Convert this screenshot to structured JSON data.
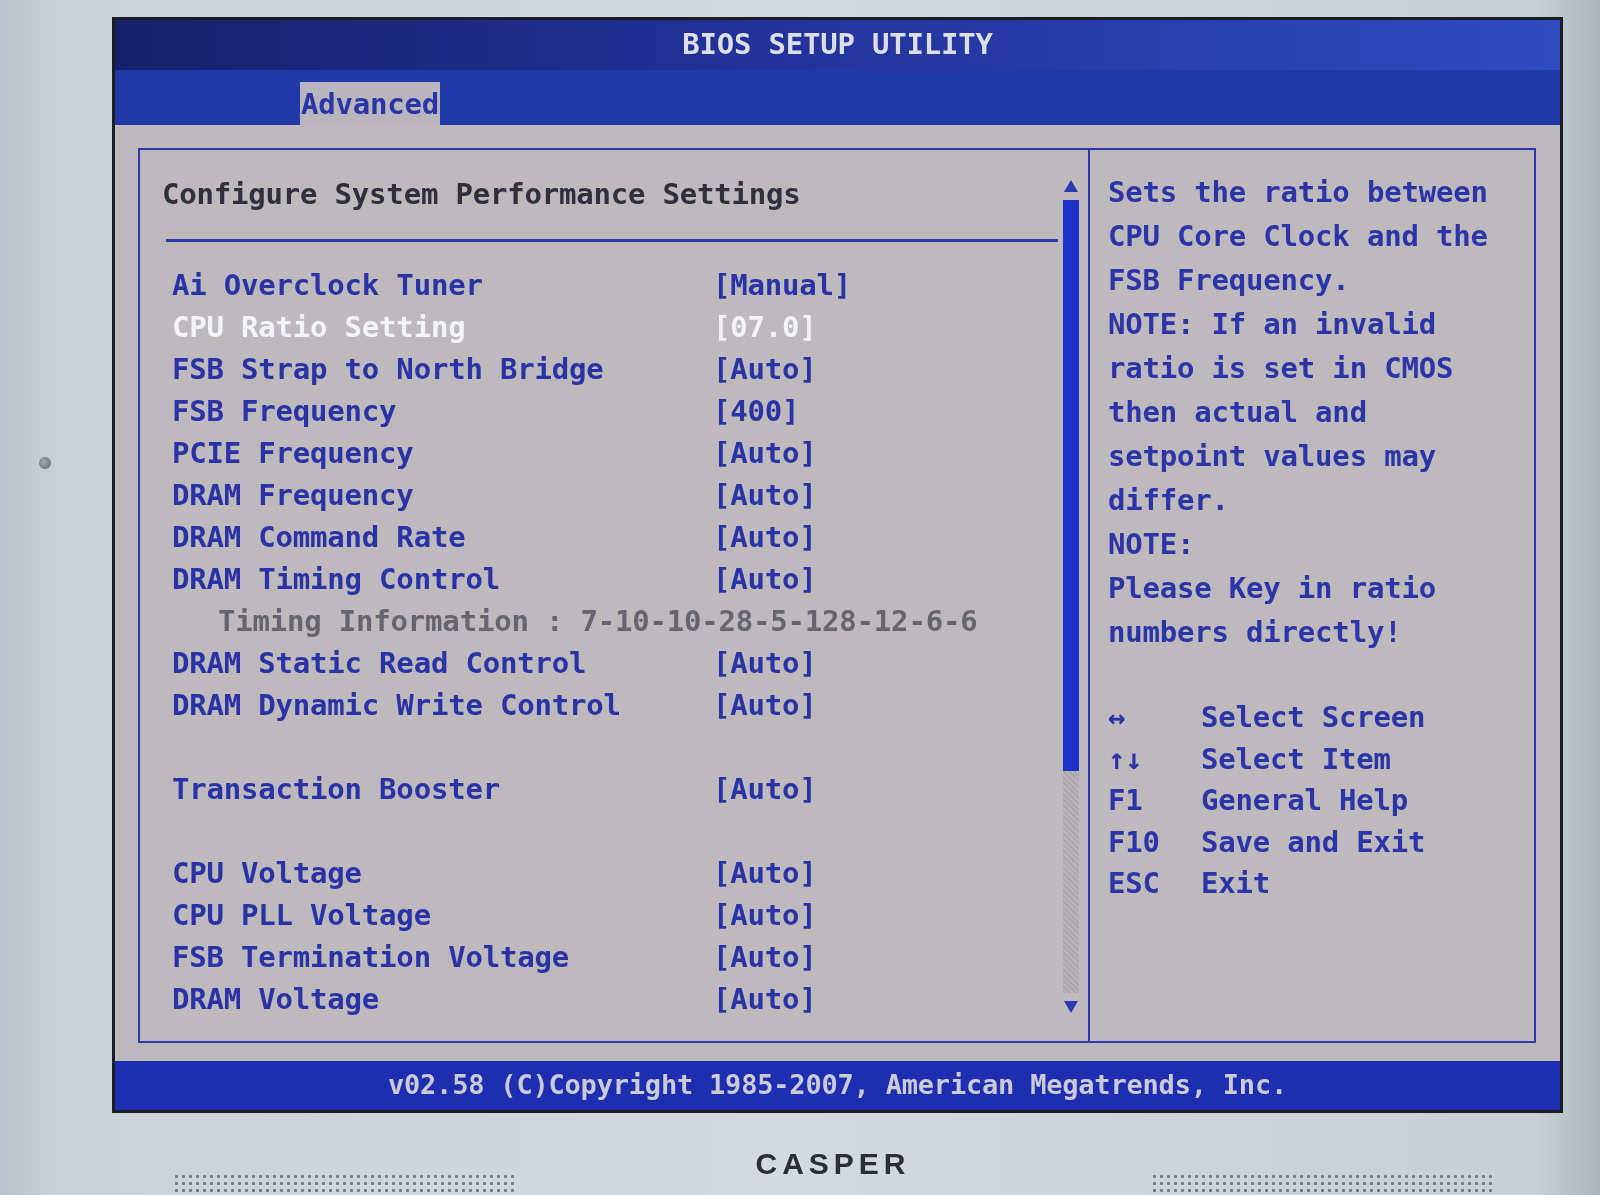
{
  "monitor": {
    "brand": "CASPER"
  },
  "bios": {
    "title": "BIOS SETUP UTILITY",
    "tabs": [
      {
        "label": "Advanced",
        "selected": true
      }
    ],
    "settings_panel": {
      "heading": "Configure System Performance Settings",
      "sections": [
        {
          "rows": [
            {
              "kind": "setting",
              "label": "Ai Overclock Tuner",
              "value": "[Manual]",
              "selected": false
            },
            {
              "kind": "setting",
              "label": "CPU Ratio Setting",
              "value": "[07.0]",
              "selected": true
            },
            {
              "kind": "setting",
              "label": "FSB Strap to North Bridge",
              "value": "[Auto]",
              "selected": false
            },
            {
              "kind": "setting",
              "label": "FSB Frequency",
              "value": "[400]",
              "selected": false
            },
            {
              "kind": "setting",
              "label": "PCIE Frequency",
              "value": "[Auto]",
              "selected": false
            },
            {
              "kind": "setting",
              "label": "DRAM Frequency",
              "value": "[Auto]",
              "selected": false
            },
            {
              "kind": "setting",
              "label": "DRAM Command Rate",
              "value": "[Auto]",
              "selected": false
            },
            {
              "kind": "setting",
              "label": "DRAM Timing Control",
              "value": "[Auto]",
              "selected": false
            },
            {
              "kind": "info",
              "text": "Timing Information : 7-10-10-28-5-128-12-6-6"
            },
            {
              "kind": "setting",
              "label": "DRAM Static Read Control",
              "value": "[Auto]",
              "selected": false
            },
            {
              "kind": "setting",
              "label": "DRAM Dynamic Write Control",
              "value": "[Auto]",
              "selected": false
            }
          ]
        },
        {
          "rows": [
            {
              "kind": "setting",
              "label": "Transaction Booster",
              "value": "[Auto]",
              "selected": false
            }
          ]
        },
        {
          "rows": [
            {
              "kind": "setting",
              "label": "CPU Voltage",
              "value": "[Auto]",
              "selected": false
            },
            {
              "kind": "setting",
              "label": "CPU PLL Voltage",
              "value": "[Auto]",
              "selected": false
            },
            {
              "kind": "setting",
              "label": "FSB Termination Voltage",
              "value": "[Auto]",
              "selected": false
            },
            {
              "kind": "setting",
              "label": "DRAM Voltage",
              "value": "[Auto]",
              "selected": false
            }
          ]
        }
      ]
    },
    "help_panel": {
      "paragraphs": [
        "Sets the ratio between CPU Core Clock and the FSB Frequency.",
        "NOTE: If an invalid ratio is set in CMOS then actual and setpoint values may differ.",
        "NOTE:",
        "Please Key in ratio numbers directly!"
      ],
      "legend": [
        {
          "key": "↔",
          "action": "Select Screen"
        },
        {
          "key": "↑↓",
          "action": "Select Item"
        },
        {
          "key": "F1",
          "action": "General Help"
        },
        {
          "key": "F10",
          "action": "Save and Exit"
        },
        {
          "key": "ESC",
          "action": "Exit"
        }
      ]
    },
    "footer": "v02.58 (C)Copyright 1985-2007, American Megatrends, Inc."
  }
}
